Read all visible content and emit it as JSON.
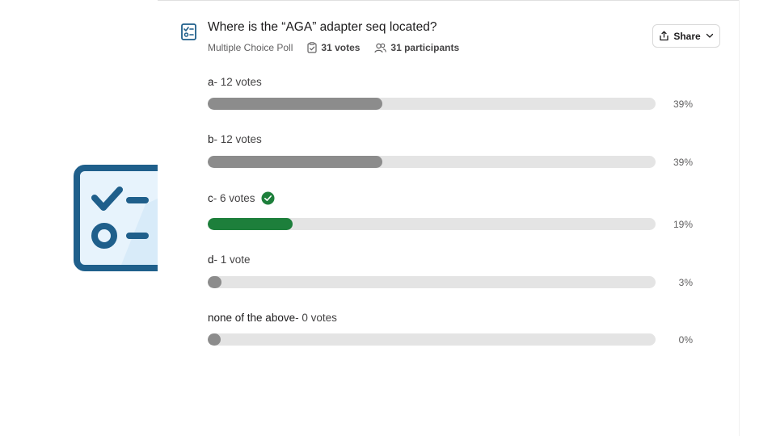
{
  "poll": {
    "title": "Where is the “AGA” adapter seq located?",
    "type_label": "Multiple Choice Poll",
    "votes_label": "31 votes",
    "participants_label": "31 participants",
    "share_label": "Share"
  },
  "options": [
    {
      "letter": "a",
      "votes_text": " - 12 votes",
      "percent_label": "39%",
      "fraction": 0.39,
      "correct": false
    },
    {
      "letter": "b",
      "votes_text": " - 12 votes",
      "percent_label": "39%",
      "fraction": 0.39,
      "correct": false
    },
    {
      "letter": "c",
      "votes_text": " - 6 votes",
      "percent_label": "19%",
      "fraction": 0.19,
      "correct": true
    },
    {
      "letter": "d",
      "votes_text": " - 1 vote",
      "percent_label": "3%",
      "fraction": 0.03,
      "correct": false
    },
    {
      "letter": "none of the above",
      "votes_text": " - 0 votes",
      "percent_label": "0%",
      "fraction": 0.0,
      "correct": false
    }
  ],
  "colors": {
    "bar_default": "#8c8c8c",
    "bar_correct": "#1d7f3b",
    "track": "#e4e4e4",
    "icon_blue": "#1f5f8b"
  },
  "icons": {
    "poll": "poll-checklist-icon",
    "votes": "clipboard-check-icon",
    "participants": "people-icon",
    "share": "share-upload-icon",
    "dropdown": "chevron-down-icon",
    "correct": "check-circle-icon",
    "logo": "checklist-logo-icon"
  }
}
